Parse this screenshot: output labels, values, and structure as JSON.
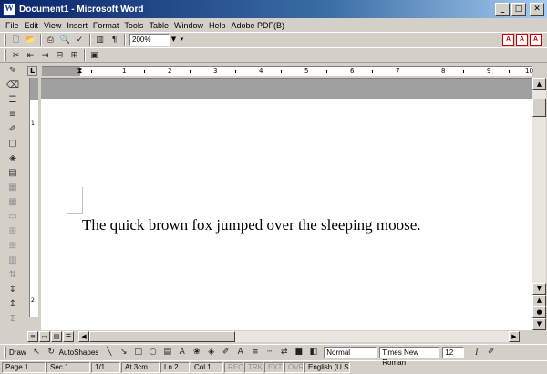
{
  "window": {
    "title": "Document1 - Microsoft Word",
    "icon": "W",
    "buttons": {
      "minimize": "_",
      "maximize": "□",
      "close": "✕"
    }
  },
  "menu": [
    "File",
    "Edit",
    "View",
    "Insert",
    "Format",
    "Tools",
    "Table",
    "Window",
    "Help",
    "Adobe PDF(B)"
  ],
  "standard_toolbar": {
    "icons": [
      "new-icon",
      "open-icon",
      "save-icon",
      "print-icon",
      "print-preview-icon",
      "spelling-icon",
      "columns-icon",
      "show-formatting-icon"
    ],
    "zoom": "200%"
  },
  "ruler": {
    "numbers": [
      "1",
      "2",
      "3",
      "4",
      "5",
      "6",
      "7",
      "8",
      "9",
      "10"
    ]
  },
  "vertical_ruler": {
    "numbers": [
      "1",
      "2"
    ]
  },
  "document": {
    "text": "The quick brown fox jumped over the sleeping moose."
  },
  "drawing_toolbar": {
    "draw_label": "Draw",
    "autoshapes_label": "AutoShapes",
    "style": "Normal",
    "font": "Times New Roman",
    "size": "12"
  },
  "status": {
    "page": "Page  1",
    "section": "Sec  1",
    "pages": "1/1",
    "at": "At  3cm",
    "line": "Ln  2",
    "column": "Col  1",
    "rec": "REC",
    "trk": "TRK",
    "ext": "EXT",
    "ovr": "OVR",
    "language": "English (U.S"
  }
}
